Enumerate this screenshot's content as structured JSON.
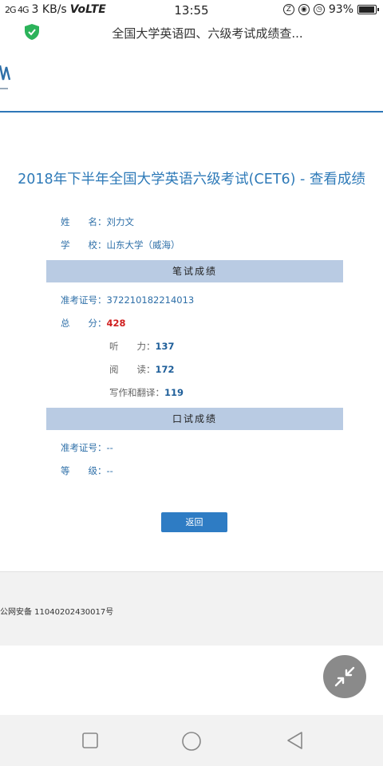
{
  "status_bar": {
    "network": "2G 4G",
    "speed": "3 KB/s",
    "volte": "VoLTE",
    "time": "13:55",
    "battery": "93%"
  },
  "browser": {
    "title": "全国大学英语四、六级考试成绩查..."
  },
  "page": {
    "title": "2018年下半年全国大学英语六级考试(CET6) - 查看成绩"
  },
  "candidate": {
    "name_label": "姓　　名：",
    "name": "刘力文",
    "school_label": "学　　校：",
    "school": "山东大学（威海）"
  },
  "written": {
    "section_title": "笔试成绩",
    "ticket_label": "准考证号：",
    "ticket_no": "372210182214013",
    "total_label": "总　　分：",
    "total": "428",
    "listening_label": "听　　力：",
    "listening": "137",
    "reading_label": "阅　　读：",
    "reading": "172",
    "writing_label": "写作和翻译：",
    "writing": "119"
  },
  "oral": {
    "section_title": "口试成绩",
    "ticket_label": "准考证号：",
    "ticket_no": "--",
    "grade_label": "等　　级：",
    "grade": "--"
  },
  "back_button": "返回",
  "footer": {
    "text": "公网安备 11040202430017号"
  },
  "colors": {
    "accent": "#2e7ab8",
    "section_bar": "#b9cbe3",
    "score_red": "#d02020",
    "button": "#2e7cc4"
  }
}
